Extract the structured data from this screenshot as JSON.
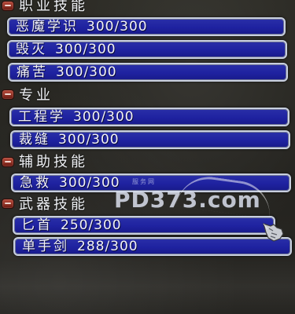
{
  "sections": [
    {
      "header": "职业技能",
      "skills": [
        {
          "name": "恶魔学识",
          "value": "300/300"
        },
        {
          "name": "毁灭",
          "value": "300/300"
        },
        {
          "name": "痛苦",
          "value": "300/300"
        }
      ]
    },
    {
      "header": "专业",
      "skills": [
        {
          "name": "工程学",
          "value": "300/300"
        },
        {
          "name": "裁缝",
          "value": "300/300"
        }
      ]
    },
    {
      "header": "辅助技能",
      "skills": [
        {
          "name": "急救",
          "value": "300/300"
        }
      ]
    },
    {
      "header": "武器技能",
      "skills": [
        {
          "name": "匕首",
          "value": "250/300"
        },
        {
          "name": "单手剑",
          "value": "288/300"
        }
      ]
    }
  ],
  "watermark": {
    "text": "PD373.com",
    "subtext": "服务网"
  },
  "colors": {
    "bar_fill": "#1f22a0",
    "bar_border": "#c8cfdf",
    "collapse_button": "#8a2a1e"
  },
  "icons": {
    "collapse": "minus-icon",
    "cursor": "gauntlet-cursor-icon"
  }
}
